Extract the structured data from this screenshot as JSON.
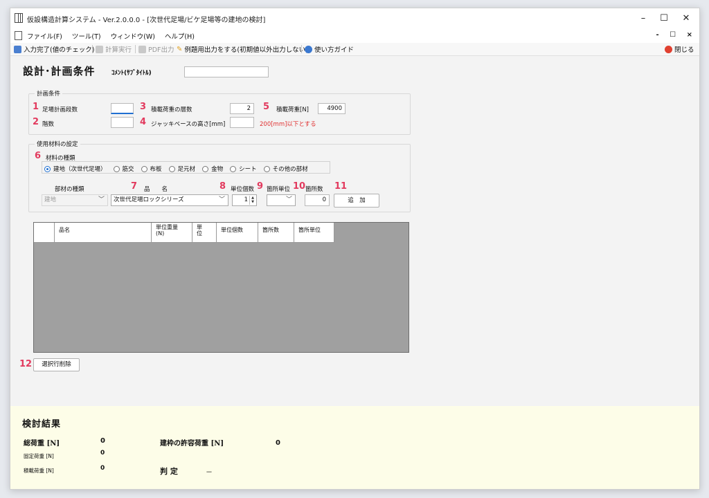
{
  "window": {
    "title": "仮設構造計算システム - Ver.2.0.0.0 - [次世代足場/ビケ足場等の建地の検討]",
    "controls": {
      "minimize": "–",
      "maximize": "☐",
      "close": "✕"
    }
  },
  "menu": {
    "items": [
      "ファイル(F)",
      "ツール(T)",
      "ウィンドウ(W)",
      "ヘルプ(H)"
    ],
    "mdi_controls": "- ☐ ×"
  },
  "toolbar": {
    "input_complete": "入力完了(値のチェック)",
    "calc_run": "計算実行",
    "pdf_output": "PDF出力",
    "example_output": "例題用出力をする(初期値以外出力しない)",
    "guide": "使い方ガイド",
    "close": "閉じる"
  },
  "header": {
    "title": "設計･計画条件",
    "comment_label": "ｺﾒﾝﾄ(ｻﾌﾞﾀｲﾄﾙ)",
    "comment_value": ""
  },
  "plan": {
    "group_title": "計画条件",
    "scaffold_stages_label": "足場計画段数",
    "scaffold_stages_value": "",
    "floors_label": "階数",
    "floors_value": "",
    "loaded_floors_label": "積載荷重の層数",
    "loaded_floors_value": "2",
    "jack_base_label": "ジャッキベースの高さ[mm]",
    "jack_base_value": "",
    "jack_base_note": "200[mm]以下とする",
    "load_label": "積載荷重[N]",
    "load_value": "4900"
  },
  "materials": {
    "group_title": "使用材料の設定",
    "type_label": "材料の種類",
    "radio_options": [
      "建地（次世代足場）",
      "筋交",
      "布板",
      "足元材",
      "金物",
      "シート",
      "その他の部材"
    ],
    "selected_index": 0,
    "part_type_label": "部材の種類",
    "part_type_value": "建地",
    "product_name_label": "品　　名",
    "product_name_value": "次世代足場ロックシリーズ",
    "unit_count_label": "単位個数",
    "unit_count_value": "1",
    "location_unit_label": "箇所単位",
    "location_unit_value": "",
    "location_count_label": "箇所数",
    "location_count_value": "0",
    "add_button": "追　加"
  },
  "table": {
    "columns": [
      "",
      "品名",
      "単位重量\n(N)",
      "単\n位",
      "単位個数",
      "箇所数",
      "箇所単位"
    ],
    "rows": []
  },
  "delete_button": "選択行削除",
  "badges": [
    "1",
    "2",
    "3",
    "4",
    "5",
    "6",
    "7",
    "8",
    "9",
    "10",
    "11",
    "12"
  ],
  "results": {
    "title": "検討結果",
    "total_load_label": "総荷重 [N]",
    "total_load_value": "0",
    "fixed_load_label": "固定荷重 [N]",
    "fixed_load_value": "0",
    "loaded_load_label": "積載荷重 [N]",
    "loaded_load_value": "0",
    "allowable_label": "建枠の許容荷重 [N]",
    "allowable_value": "0",
    "judgement_label": "判 定",
    "judgement_value": "－"
  },
  "colors": {
    "badge": "#e23a5e",
    "note_red": "#e03030",
    "results_bg": "#fdfde8",
    "grid_gray": "#a0a0a0"
  }
}
